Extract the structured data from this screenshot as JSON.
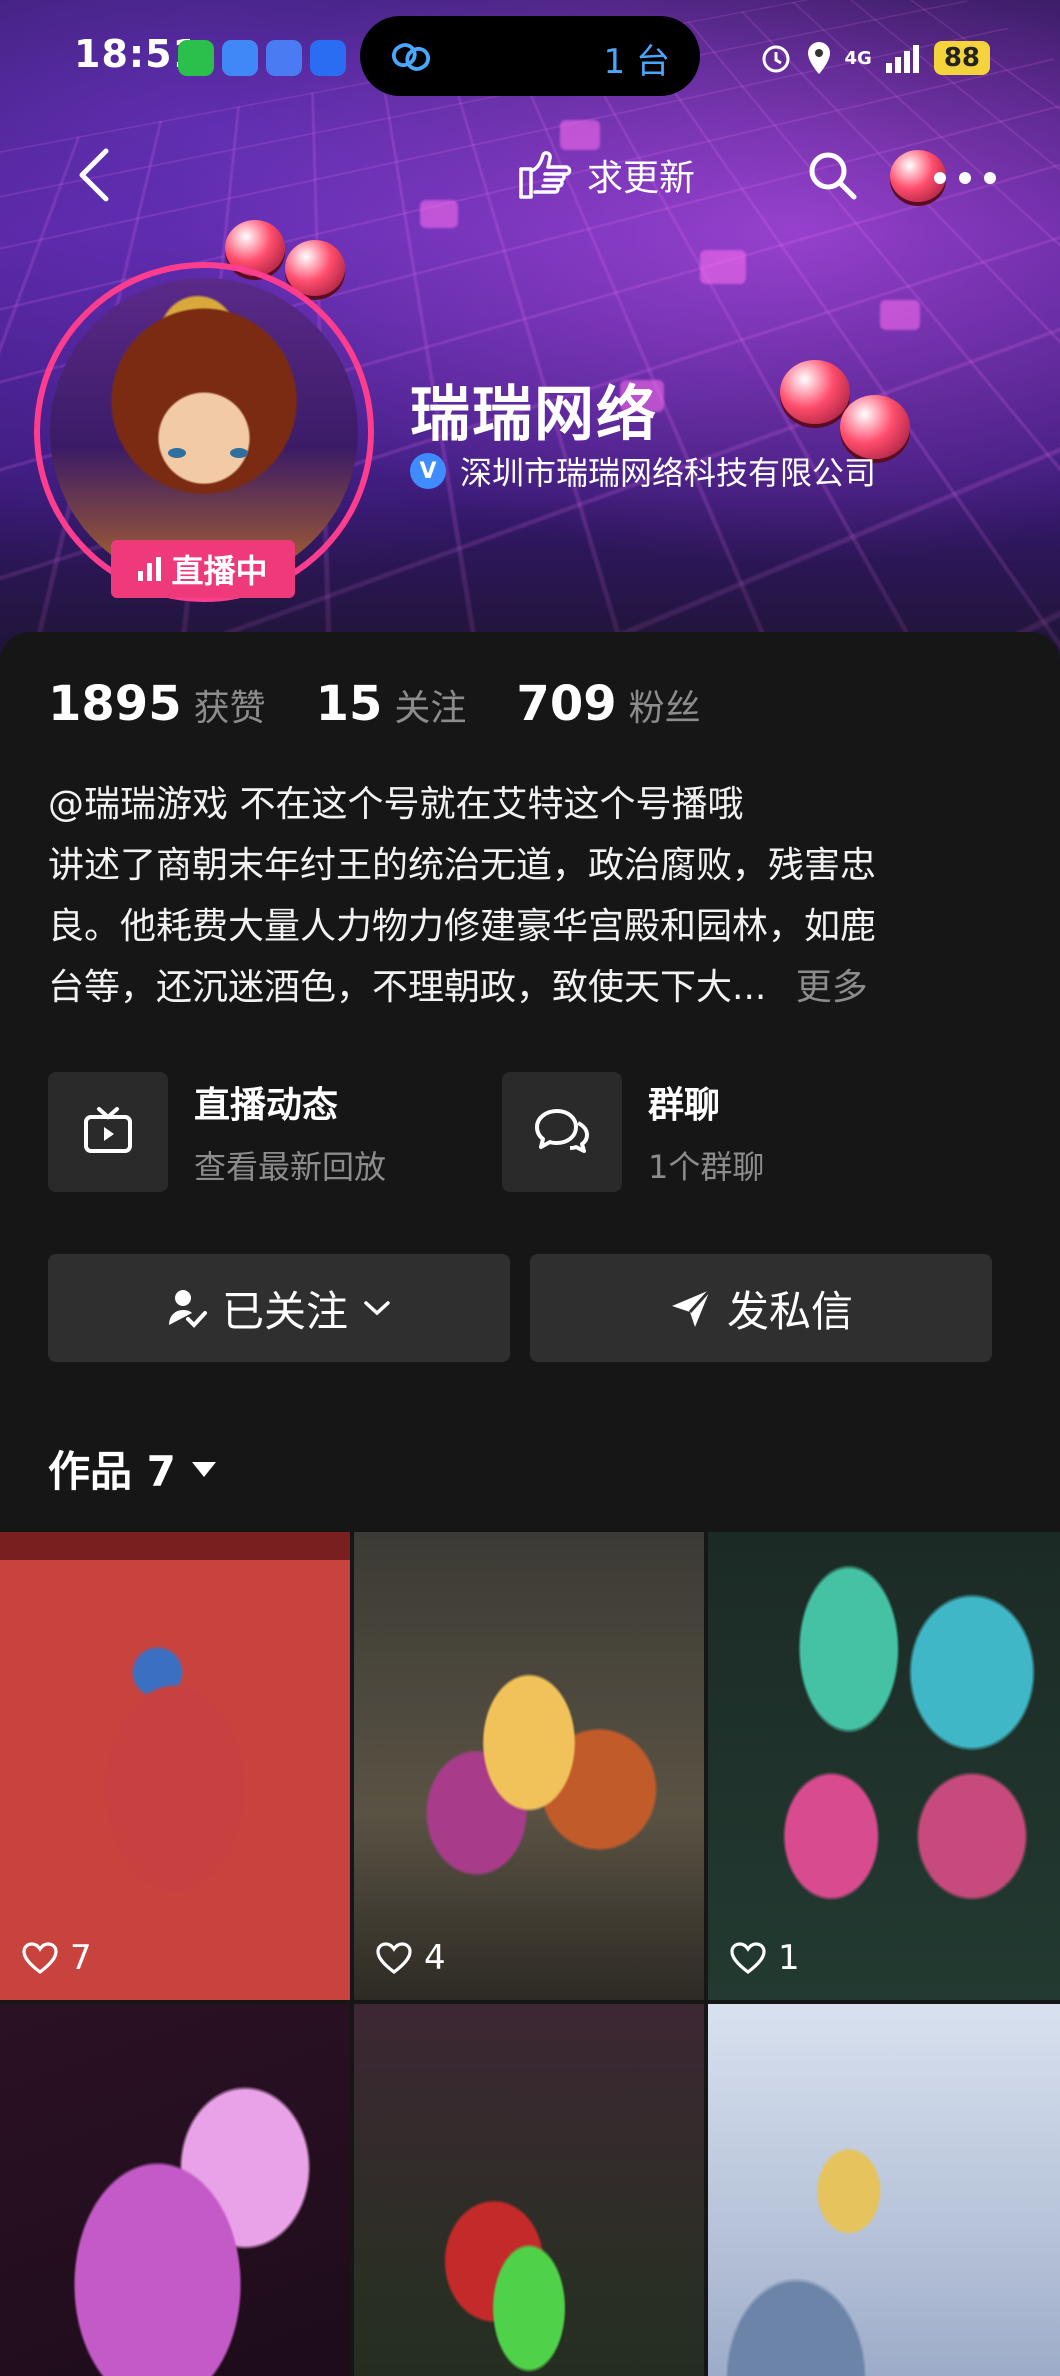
{
  "status_bar": {
    "time": "18:51",
    "island_count": "1 台",
    "network": "4G",
    "battery": "88"
  },
  "nav": {
    "update_label": "求更新"
  },
  "profile": {
    "live_badge": "直播中",
    "name": "瑞瑞网络",
    "verified_org": "深圳市瑞瑞网络科技有限公司"
  },
  "stats": {
    "likes_value": "1895",
    "likes_label": "获赞",
    "following_value": "15",
    "following_label": "关注",
    "fans_value": "709",
    "fans_label": "粉丝"
  },
  "bio": {
    "line1": "@瑞瑞游戏 不在这个号就在艾特这个号播哦",
    "line2": "讲述了商朝末年纣王的统治无道，政治腐败，残害忠",
    "line3": "良。他耗费大量人力物力修建豪华宫殿和园林，如鹿",
    "line4": "台等，还沉迷酒色，不理朝政，致使天下大...",
    "more": "更多"
  },
  "cards": {
    "live": {
      "title": "直播动态",
      "subtitle": "查看最新回放"
    },
    "group": {
      "title": "群聊",
      "subtitle": "1个群聊"
    }
  },
  "buttons": {
    "following": "已关注",
    "message": "发私信"
  },
  "works": {
    "label": "作品 7",
    "items": [
      {
        "likes": "7"
      },
      {
        "likes": "4"
      },
      {
        "likes": "1"
      },
      {
        "likes": ""
      },
      {
        "likes": ""
      },
      {
        "likes": ""
      }
    ]
  }
}
